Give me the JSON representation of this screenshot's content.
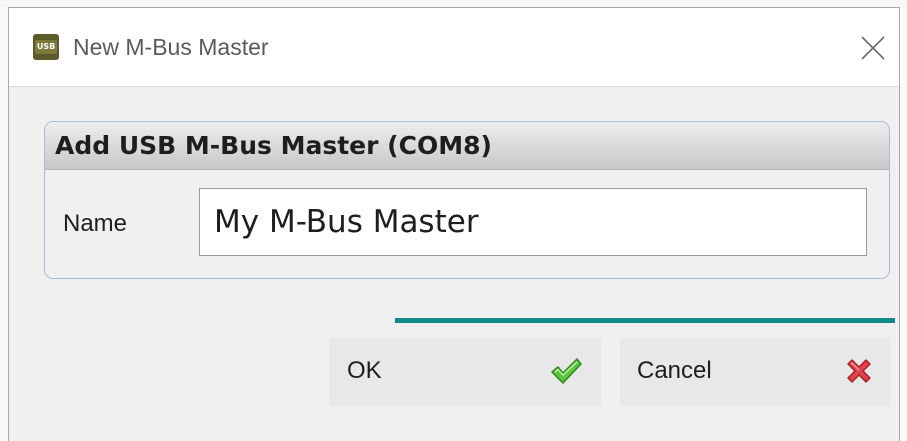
{
  "window": {
    "title": "New M-Bus Master",
    "app_icon_text": "USB",
    "app_icon": "usb-app-icon",
    "close_icon": "close-icon"
  },
  "group": {
    "title": "Add USB M-Bus Master (COM8)",
    "name_label": "Name",
    "name_value": "My M-Bus Master"
  },
  "buttons": {
    "ok_label": "OK",
    "ok_icon": "checkmark-icon",
    "cancel_label": "Cancel",
    "cancel_icon": "red-x-icon"
  },
  "colors": {
    "accent_line": "#138a8a",
    "ok_green": "#3fae2a",
    "cancel_red": "#d9303a"
  }
}
